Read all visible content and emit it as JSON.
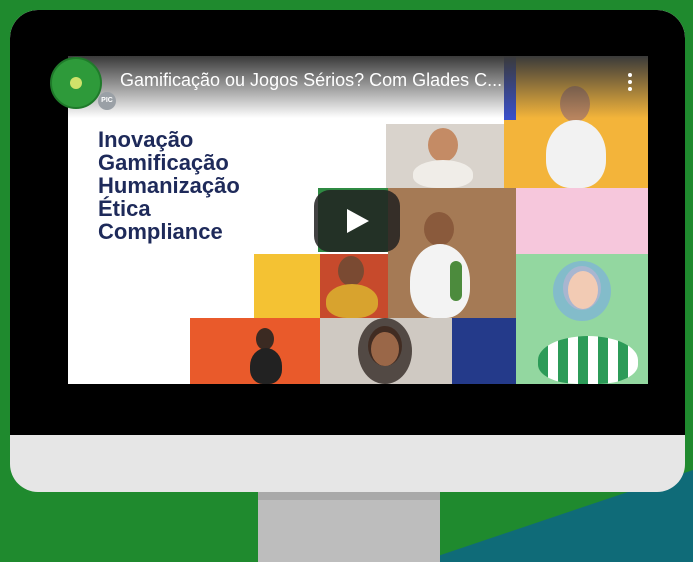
{
  "video": {
    "title": "Gamificação ou Jogos Sérios? Com Glades C...",
    "channel_badge": "PIC",
    "thumbnail_words": [
      "Inovação",
      "Gamificação",
      "Humanização",
      "Ética",
      "Compliance"
    ]
  },
  "icons": {
    "play": "play-icon",
    "menu": "kebab-menu-icon",
    "channel": "channel-avatar-icon"
  },
  "colors": {
    "background_green": "#1f8a2e",
    "background_teal": "#0f6b78",
    "text_navy": "#1e2a5a"
  }
}
